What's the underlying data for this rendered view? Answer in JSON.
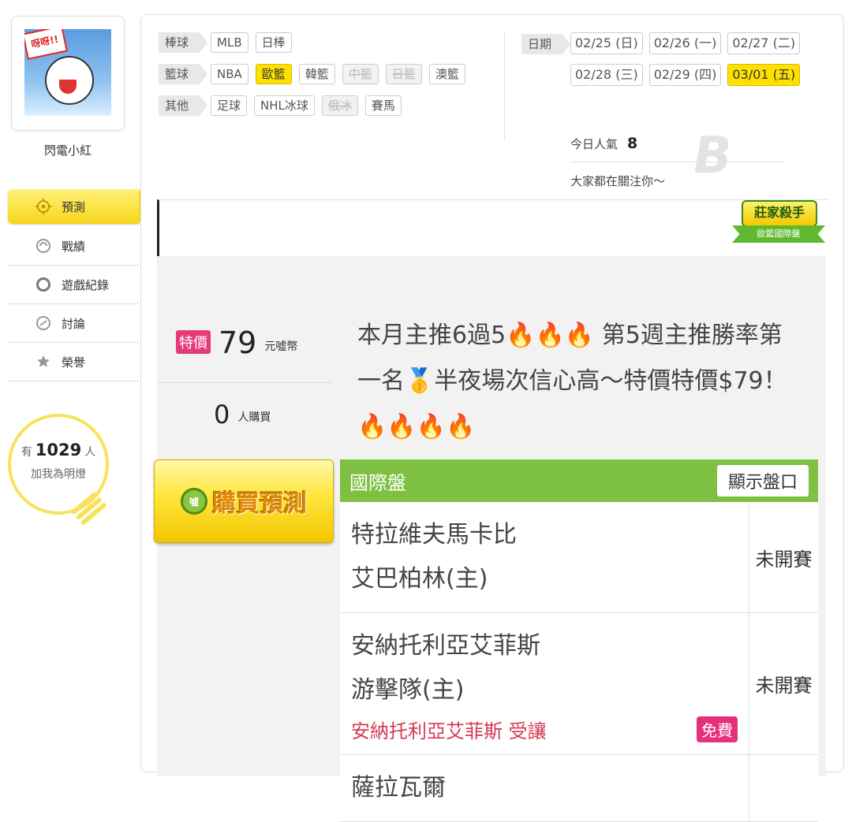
{
  "profile": {
    "avatar_caption": "呀呀!!",
    "name": "閃電小紅"
  },
  "nav": [
    {
      "label": "預測",
      "icon": "target-icon",
      "active": true
    },
    {
      "label": "戰績",
      "icon": "record-icon",
      "active": false
    },
    {
      "label": "遊戲紀錄",
      "icon": "circle-icon",
      "active": false
    },
    {
      "label": "討論",
      "icon": "discuss-icon",
      "active": false
    },
    {
      "label": "榮譽",
      "icon": "trophy-icon",
      "active": false
    }
  ],
  "fans": {
    "prefix": "有",
    "count": "1029",
    "suffix": "人",
    "line2": "加我為明燈"
  },
  "filters": {
    "baseball": {
      "label": "棒球",
      "chips": [
        "MLB",
        "日棒"
      ]
    },
    "basketball": {
      "label": "籃球",
      "chips": [
        "NBA",
        "歐籃",
        "韓籃",
        "中籃",
        "日籃",
        "澳籃"
      ]
    },
    "other": {
      "label": "其他",
      "chips": [
        "足球",
        "NHL冰球",
        "俄冰",
        "賽馬"
      ]
    }
  },
  "dates": {
    "label": "日期",
    "items": [
      "02/25 (日)",
      "02/26 (一)",
      "02/27 (二)",
      "02/28 (三)",
      "02/29 (四)",
      "03/01 (五)"
    ],
    "selected": "03/01 (五)"
  },
  "popularity": {
    "label": "今日人氣",
    "value": "8",
    "attention": "大家都在關注你～"
  },
  "badge": {
    "title": "莊家殺手",
    "subtitle": "歐籃國際盤"
  },
  "offer": {
    "tag": "特價",
    "price": "79",
    "price_unit": "元噓幣",
    "buyers": "0",
    "buyers_unit": "人購買",
    "buy_button": "購買預測",
    "coin_text": "噓"
  },
  "pitch": "本月主推6過5🔥🔥🔥 第5週主推勝率第一名🥇半夜場次信心高～特價特價$79！🔥🔥🔥🔥",
  "table": {
    "header": "國際盤",
    "show_odds": "顯示盤口",
    "rows": [
      {
        "team1": "特拉維夫馬卡比",
        "team2": "艾巴柏林(主)",
        "status": "未開賽",
        "pick": "",
        "free": ""
      },
      {
        "team1": "安納托利亞艾菲斯",
        "team2": "游擊隊(主)",
        "status": "未開賽",
        "pick": "安納托利亞艾菲斯 受讓",
        "free": "免費"
      },
      {
        "team1": "薩拉瓦爾",
        "team2": "",
        "status": "",
        "pick": "",
        "free": ""
      }
    ]
  },
  "colors": {
    "accent_yellow": "#ffe100",
    "green": "#7dc042",
    "pink": "#e63a7b"
  }
}
